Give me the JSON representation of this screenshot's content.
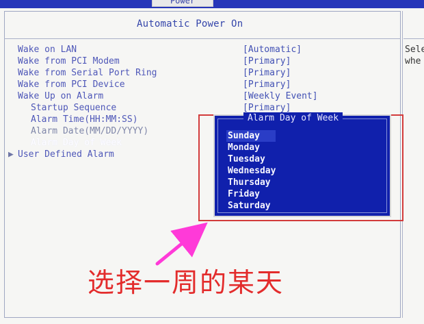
{
  "top_tab": "Power",
  "panel": {
    "title": "Automatic Power On"
  },
  "menu": {
    "items": [
      {
        "label": "Wake on LAN",
        "value": "[Automatic]"
      },
      {
        "label": "Wake from PCI Modem",
        "value": "[Primary]"
      },
      {
        "label": "Wake from Serial Port Ring",
        "value": "[Primary]"
      },
      {
        "label": "Wake from PCI Device",
        "value": "[Primary]"
      },
      {
        "label": "Wake Up on Alarm",
        "value": "[Weekly Event]"
      },
      {
        "label": "Startup Sequence",
        "value": "[Primary]"
      },
      {
        "label": "Alarm Time(HH:MM:SS)",
        "value": ""
      },
      {
        "label": "Alarm Date(MM/DD/YYYY)",
        "value": ""
      },
      {
        "label": "Alarm Day of Week",
        "value": ""
      },
      {
        "label": "User Defined Alarm",
        "value": ""
      }
    ]
  },
  "help": {
    "line1": "Sele",
    "line2": "whe"
  },
  "popup": {
    "title": "Alarm Day of Week",
    "options": [
      "Sunday",
      "Monday",
      "Tuesday",
      "Wednesday",
      "Thursday",
      "Friday",
      "Saturday"
    ],
    "selected": "Sunday"
  },
  "annotation": {
    "caption": "选择一周的某天"
  },
  "colors": {
    "bios_blue": "#1020ac",
    "menu_text": "#4e57b8",
    "annotation_red": "#e32c2c",
    "arrow_magenta": "#ff3ad8"
  }
}
